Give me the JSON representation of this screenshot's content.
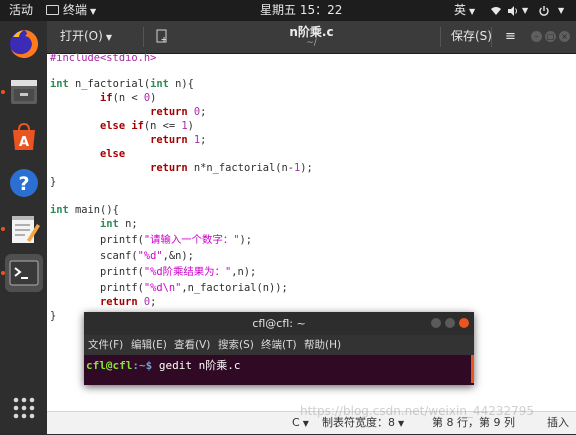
{
  "topbar": {
    "activities": "活动",
    "app_menu": "终端",
    "clock": "星期五 15：22",
    "input_method": "英"
  },
  "dock": {
    "apps": [
      "firefox-icon",
      "files-icon",
      "software-center-icon",
      "help-icon",
      "text-editor-icon",
      "terminal-icon"
    ],
    "show_apps": "show-apps-icon"
  },
  "gedit": {
    "open_label": "打开(O)",
    "filename": "n阶乘.c",
    "path": "~/",
    "save_label": "保存(S)",
    "code_lines": [
      "#include<stdio.h>",
      "",
      "int n_factorial(int n){",
      "        if(n < 0)",
      "                return 0;",
      "        else if(n <= 1)",
      "                return 1;",
      "        else",
      "                return n*n_factorial(n-1);",
      "}",
      "",
      "int main(){",
      "        int n;",
      "        printf(\"请输入一个数字：\");",
      "        scanf(\"%d\",&n);",
      "        printf(\"%d阶乘结果为：\",n);",
      "        printf(\"%d\\n\",n_factorial(n));",
      "        return 0;",
      "}"
    ],
    "status": {
      "language": "C",
      "tab_width": "制表符宽度：8",
      "position": "第 8 行，第 9 列",
      "mode": "插入"
    }
  },
  "terminal": {
    "title": "cfl@cfl: ~",
    "menu": [
      "文件(F)",
      "编辑(E)",
      "查看(V)",
      "搜索(S)",
      "终端(T)",
      "帮助(H)"
    ],
    "prompt_user": "cfl@cfl",
    "prompt_path": ":~$",
    "command": " gedit n阶乘.c"
  },
  "watermark": "https://blog.csdn.net/weixin_44232795"
}
